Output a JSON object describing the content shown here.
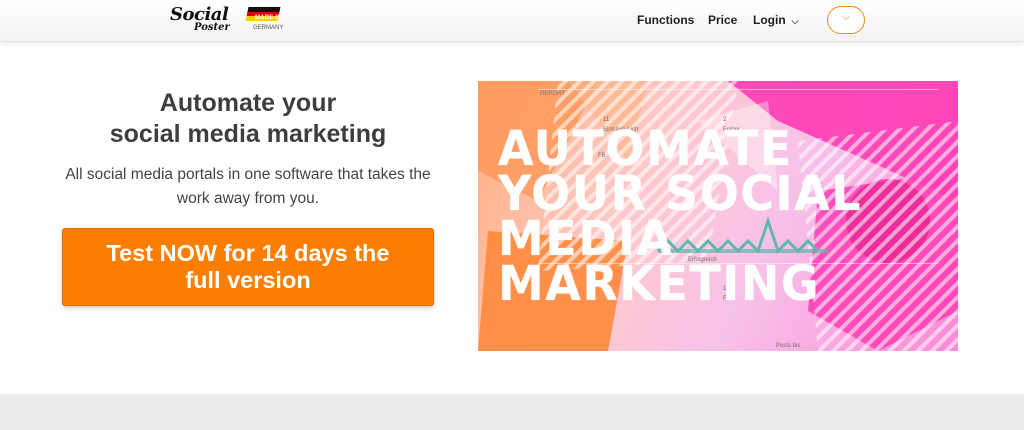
{
  "header": {
    "logo_text_main": "Social",
    "logo_text_sub": "Poster",
    "badge_line1": "MADE IN",
    "badge_line2": "GERMANY",
    "nav": {
      "functions": "Functions",
      "price": "Price",
      "login": "Login"
    },
    "language_dropdown_icon": "chevron-down-icon"
  },
  "hero": {
    "title_line1": "Automate your",
    "title_line2": "social media marketing",
    "subtitle_line1": "All social media portals in one software that takes the",
    "subtitle_line2": "work away from you.",
    "cta_line1": "Test NOW for 14 days the",
    "cta_line2": "full version",
    "image_text": [
      "AUTOMATE",
      "YOUR SOCIAL",
      "MEDIA",
      "MARKETING"
    ],
    "image_small_labels": [
      "REPORT",
      "Einträge-Lich",
      "Fehler",
      "Erfolgreich",
      "Fehl",
      "Posts bis"
    ],
    "image_small_numbers": [
      "11",
      "2",
      "12",
      "FB"
    ]
  },
  "colors": {
    "accent_orange": "#fb7e00",
    "header_bg": "#f5f5f5",
    "bottom_band": "#ececec",
    "image_pink": "#ff3cb4",
    "image_orange": "#ff8a3c"
  }
}
